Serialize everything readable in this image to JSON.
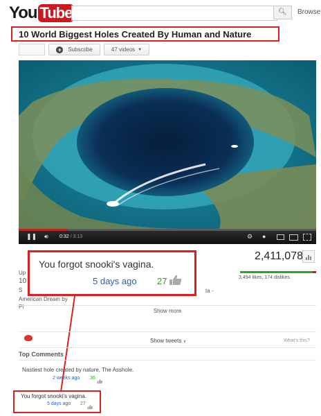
{
  "header": {
    "logo_you": "You",
    "logo_tube": "Tube",
    "search_placeholder": "",
    "browse_label": "Browse"
  },
  "video": {
    "title": "10 World Biggest Holes Created By Human and Nature",
    "subscribe_label": "Subscribe",
    "videos_count": "47 videos",
    "current_time": "0:32",
    "duration": "3:13",
    "progress": 0.166,
    "views": "2,411,078",
    "likes_text": "3,494 likes, 174 dislikes",
    "like_ratio": 0.95,
    "show_more": "Show more"
  },
  "description": {
    "lines": [
      "Up",
      "10",
      "S",
      "American Dream by",
      "Pl"
    ]
  },
  "callout": {
    "text": "You forgot snooki's vagina.",
    "date": "5 days ago",
    "likes": "27"
  },
  "tweets": {
    "show_tweets": "Show tweets",
    "whats_this": "What's this?"
  },
  "comments": {
    "heading": "Top Comments",
    "items": [
      {
        "text": "Nastiest hole created by nature, The Asshole.",
        "date": "2 weeks ago",
        "likes": "36"
      },
      {
        "text": "You forgot snooki's vagina.",
        "date": "5 days ago",
        "likes": "27"
      }
    ]
  },
  "colors": {
    "brand_red": "#cc181e",
    "highlight_red": "#e21d1d",
    "like_green": "#2ba427",
    "link_blue": "#2a5db0"
  }
}
